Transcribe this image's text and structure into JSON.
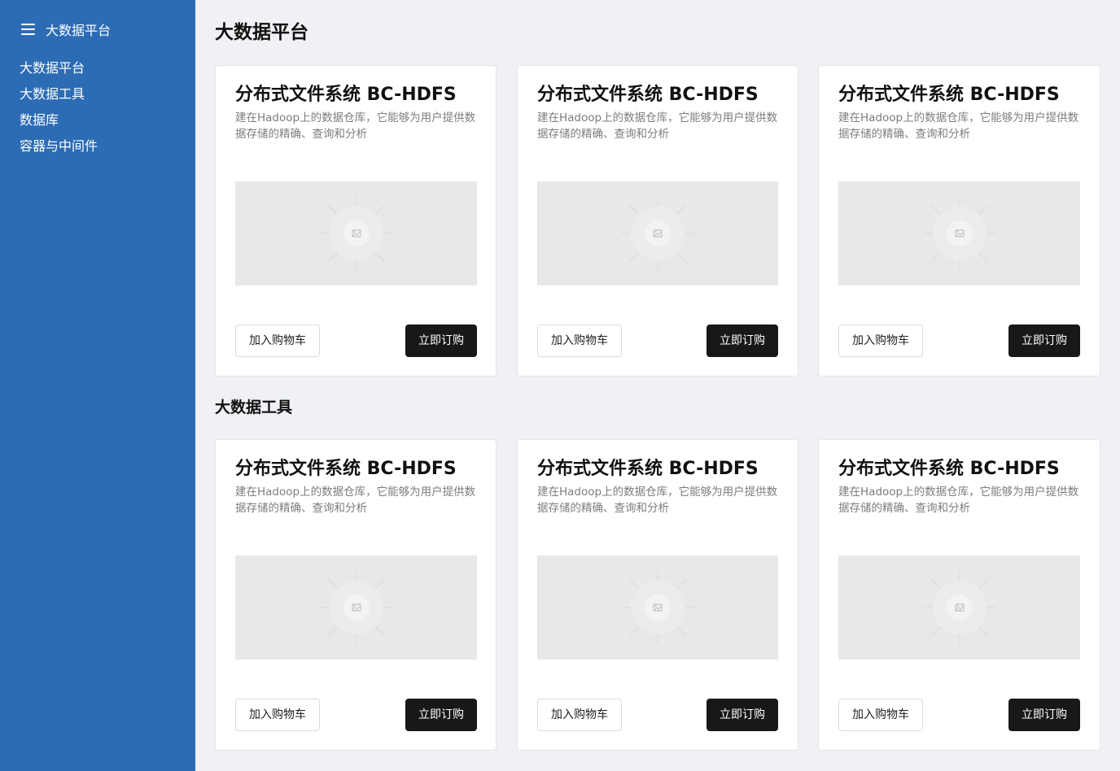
{
  "sidebar": {
    "title": "大数据平台",
    "items": [
      {
        "label": "大数据平台"
      },
      {
        "label": "大数据工具"
      },
      {
        "label": "数据库"
      },
      {
        "label": "容器与中间件"
      }
    ]
  },
  "main": {
    "page_title": "大数据平台",
    "sections": [
      {
        "cards": [
          {
            "title": "分布式文件系统 BC-HDFS",
            "desc": "建在Hadoop上的数据仓库，它能够为用户提供数据存储的精确、查询和分析",
            "cart_label": "加入购物车",
            "buy_label": "立即订购"
          },
          {
            "title": "分布式文件系统 BC-HDFS",
            "desc": "建在Hadoop上的数据仓库，它能够为用户提供数据存储的精确、查询和分析",
            "cart_label": "加入购物车",
            "buy_label": "立即订购"
          },
          {
            "title": "分布式文件系统 BC-HDFS",
            "desc": "建在Hadoop上的数据仓库，它能够为用户提供数据存储的精确、查询和分析",
            "cart_label": "加入购物车",
            "buy_label": "立即订购"
          }
        ]
      },
      {
        "title": "大数据工具",
        "cards": [
          {
            "title": "分布式文件系统 BC-HDFS",
            "desc": "建在Hadoop上的数据仓库，它能够为用户提供数据存储的精确、查询和分析",
            "cart_label": "加入购物车",
            "buy_label": "立即订购"
          },
          {
            "title": "分布式文件系统 BC-HDFS",
            "desc": "建在Hadoop上的数据仓库，它能够为用户提供数据存储的精确、查询和分析",
            "cart_label": "加入购物车",
            "buy_label": "立即订购"
          },
          {
            "title": "分布式文件系统 BC-HDFS",
            "desc": "建在Hadoop上的数据仓库，它能够为用户提供数据存储的精确、查询和分析",
            "cart_label": "加入购物车",
            "buy_label": "立即订购"
          }
        ]
      }
    ]
  },
  "colors": {
    "sidebar_bg": "#2c6cb4",
    "page_bg": "#eff1f5",
    "buy_button_bg": "#17181a",
    "placeholder_bg": "#e8e8e8"
  },
  "icons": {
    "menu": "hamburger-menu-icon",
    "placeholder": "image-placeholder-icon"
  }
}
